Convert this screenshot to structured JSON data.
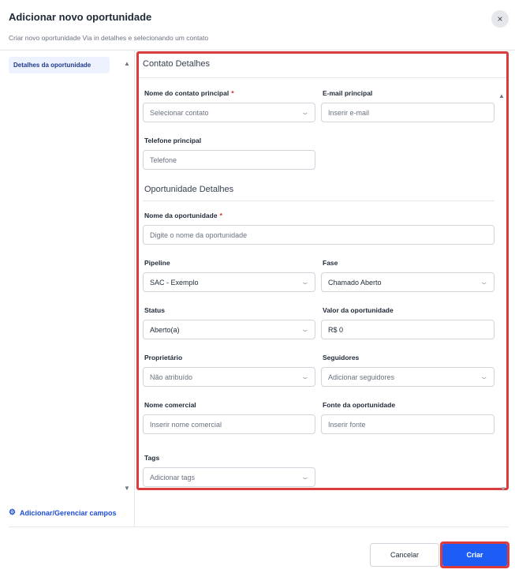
{
  "dialog": {
    "title": "Adicionar novo oportunidade",
    "subtitle": "Criar novo oportunidade Via in detalhes e selecionando um contato",
    "close_icon": "×"
  },
  "sidebar": {
    "items": [
      {
        "label": "Detalhes da oportunidade"
      }
    ],
    "manage_fields": "Adicionar/Gerenciar campos",
    "scroll_up": "▲",
    "scroll_down": "▼"
  },
  "form": {
    "contact_section": "Contato Detalhes",
    "opportunity_section": "Oportunidade Detalhes",
    "scroll_up": "▲",
    "scroll_down": "▼",
    "required_mark": "*",
    "fields": {
      "contact_name": {
        "label": "Nome do contato principal",
        "placeholder": "Selecionar contato"
      },
      "email": {
        "label": "E-mail principal",
        "placeholder": "Inserir e-mail"
      },
      "phone": {
        "label": "Telefone principal",
        "placeholder": "Telefone"
      },
      "opportunity_name": {
        "label": "Nome da oportunidade",
        "placeholder": "Digite o nome da oportunidade"
      },
      "pipeline": {
        "label": "Pipeline",
        "value": "SAC - Exemplo"
      },
      "stage": {
        "label": "Fase",
        "value": "Chamado Aberto"
      },
      "status": {
        "label": "Status",
        "value": "Aberto(a)"
      },
      "opportunity_value": {
        "label": "Valor da oportunidade",
        "value": "R$ 0"
      },
      "owner": {
        "label": "Proprietário",
        "placeholder": "Não atribuído"
      },
      "followers": {
        "label": "Seguidores",
        "placeholder": "Adicionar seguidores"
      },
      "business_name": {
        "label": "Nome comercial",
        "placeholder": "Inserir nome comercial"
      },
      "source": {
        "label": "Fonte da oportunidade",
        "placeholder": "Inserir fonte"
      },
      "tags": {
        "label": "Tags",
        "placeholder": "Adicionar tags"
      }
    }
  },
  "footer": {
    "cancel_label": "Cancelar",
    "create_label": "Criar"
  },
  "icons": {
    "chevron": "⌄",
    "gear": "⚙"
  },
  "colors": {
    "accent": "#1d5cf5",
    "highlight": "#dc3b3b",
    "link": "#1d4ed8"
  }
}
